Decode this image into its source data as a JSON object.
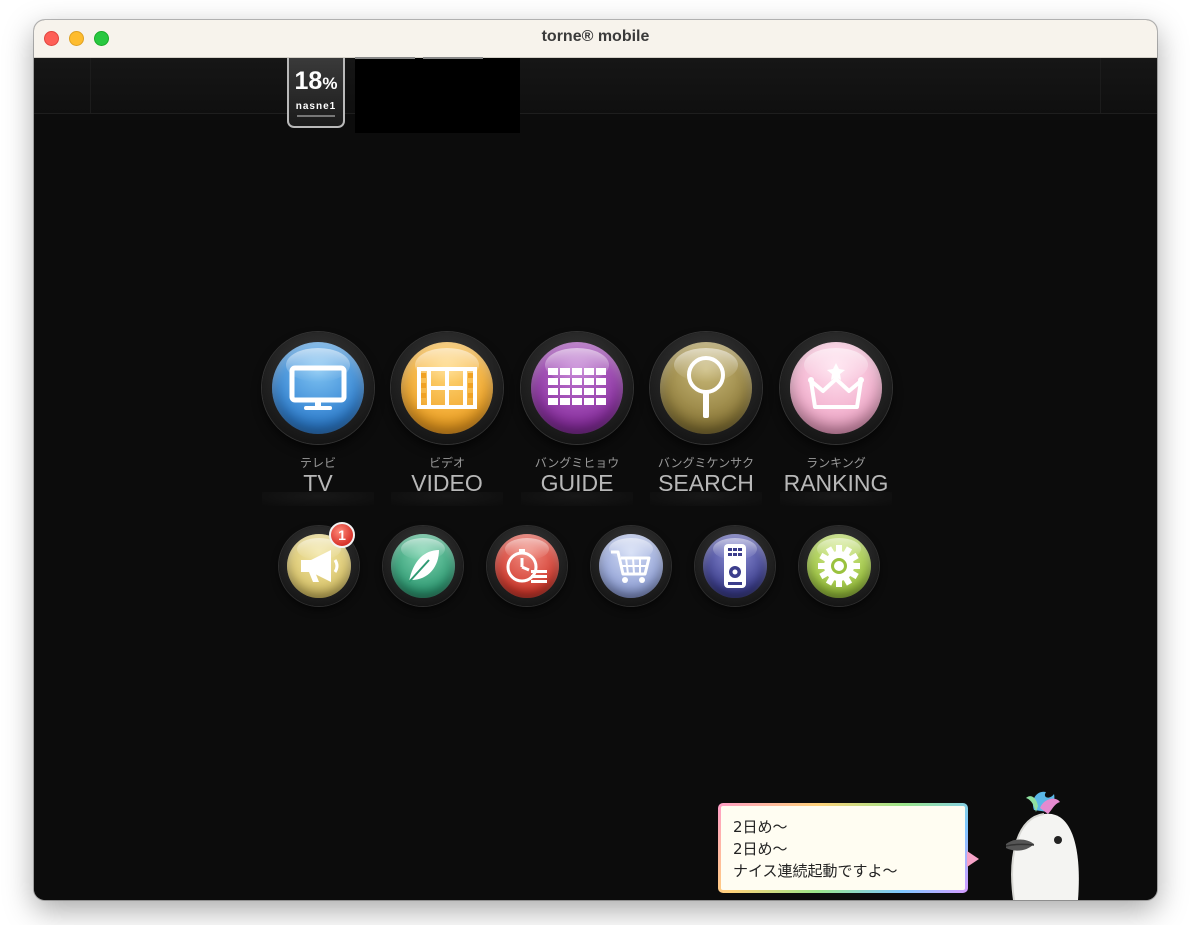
{
  "window": {
    "title": "torne® mobile"
  },
  "storage": {
    "percent": "18",
    "percent_unit": "%",
    "device": "nasne1"
  },
  "main_menu": [
    {
      "kana": "テレビ",
      "label": "TV",
      "color": "#3f8fd6",
      "icon": "tv-icon"
    },
    {
      "kana": "ビデオ",
      "label": "VIDEO",
      "color": "#f0a224",
      "icon": "film-icon"
    },
    {
      "kana": "バングミヒョウ",
      "label": "GUIDE",
      "color": "#8a2fa0",
      "icon": "grid-icon"
    },
    {
      "kana": "バングミケンサク",
      "label": "SEARCH",
      "color": "#8e7b3a",
      "icon": "magnifier-icon"
    },
    {
      "kana": "ランキング",
      "label": "RANKING",
      "color": "#f0a8c8",
      "icon": "crown-icon"
    }
  ],
  "sub_menu": [
    {
      "icon": "megaphone-icon",
      "color": "#d9c46a",
      "badge": "1"
    },
    {
      "icon": "leaf-icon",
      "color": "#2f9a73",
      "badge": ""
    },
    {
      "icon": "timer-list-icon",
      "color": "#d13a2e",
      "badge": ""
    },
    {
      "icon": "cart-icon",
      "color": "#8f9fd4",
      "badge": ""
    },
    {
      "icon": "remote-icon",
      "color": "#3b3d8c",
      "badge": ""
    },
    {
      "icon": "gear-icon",
      "color": "#9ac23e",
      "badge": ""
    }
  ],
  "bubble": {
    "line1": "2日め〜",
    "line2": "2日め〜",
    "line3": "ナイス連続起動ですよ〜"
  }
}
